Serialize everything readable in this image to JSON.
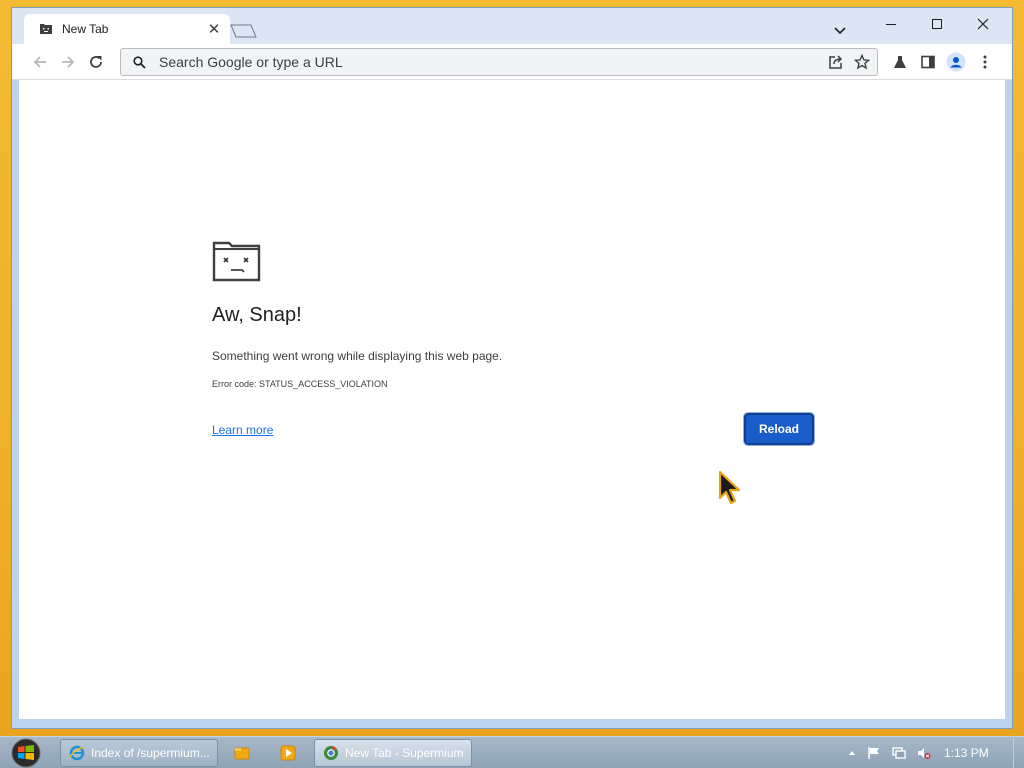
{
  "tab": {
    "title": "New Tab",
    "close_glyph": "✕"
  },
  "omnibox": {
    "placeholder": "Search Google or type a URL",
    "value": ""
  },
  "error_page": {
    "title": "Aw, Snap!",
    "description": "Something went wrong while displaying this web page.",
    "error_code": "Error code: STATUS_ACCESS_VIOLATION",
    "learn_more_label": "Learn more",
    "reload_label": "Reload"
  },
  "taskbar": {
    "items": [
      {
        "label": "Index of /supermium...",
        "icon": "internet-explorer-icon",
        "active": false
      },
      {
        "label": "New Tab - Supermium",
        "icon": "chrome-icon",
        "active": true
      }
    ],
    "quick_launch": [
      "folder-icon",
      "media-player-icon"
    ],
    "tray_icons": [
      "show-hidden-icons-arrow",
      "action-center-flag-icon",
      "network-icon",
      "volume-muted-icon"
    ],
    "clock": "1:13 PM"
  },
  "colors": {
    "accent": "#1a5cc9",
    "desktop": "#f2b632",
    "window_frame": "#bcd3ef",
    "link": "#1a73e8"
  }
}
